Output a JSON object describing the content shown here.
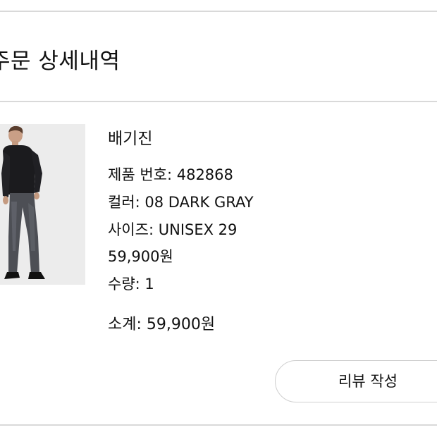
{
  "header": {
    "title": "주문 상세내역"
  },
  "order_item": {
    "name": "배기진",
    "product_number_label": "제품 번호:",
    "product_number": "482868",
    "color_label": "컬러:",
    "color": "08 DARK GRAY",
    "size_label": "사이즈:",
    "size": "UNISEX 29",
    "price": "59,900원",
    "quantity_label": "수량:",
    "quantity": "1",
    "subtotal_label": "소계:",
    "subtotal": "59,900원",
    "image_icon": "product-photo-icon"
  },
  "actions": {
    "review_button_label": "리뷰 작성"
  },
  "colors": {
    "divider": "#d9d9d9",
    "text": "#111111",
    "button_border": "#cfcfcf",
    "image_background": "#ececec"
  }
}
